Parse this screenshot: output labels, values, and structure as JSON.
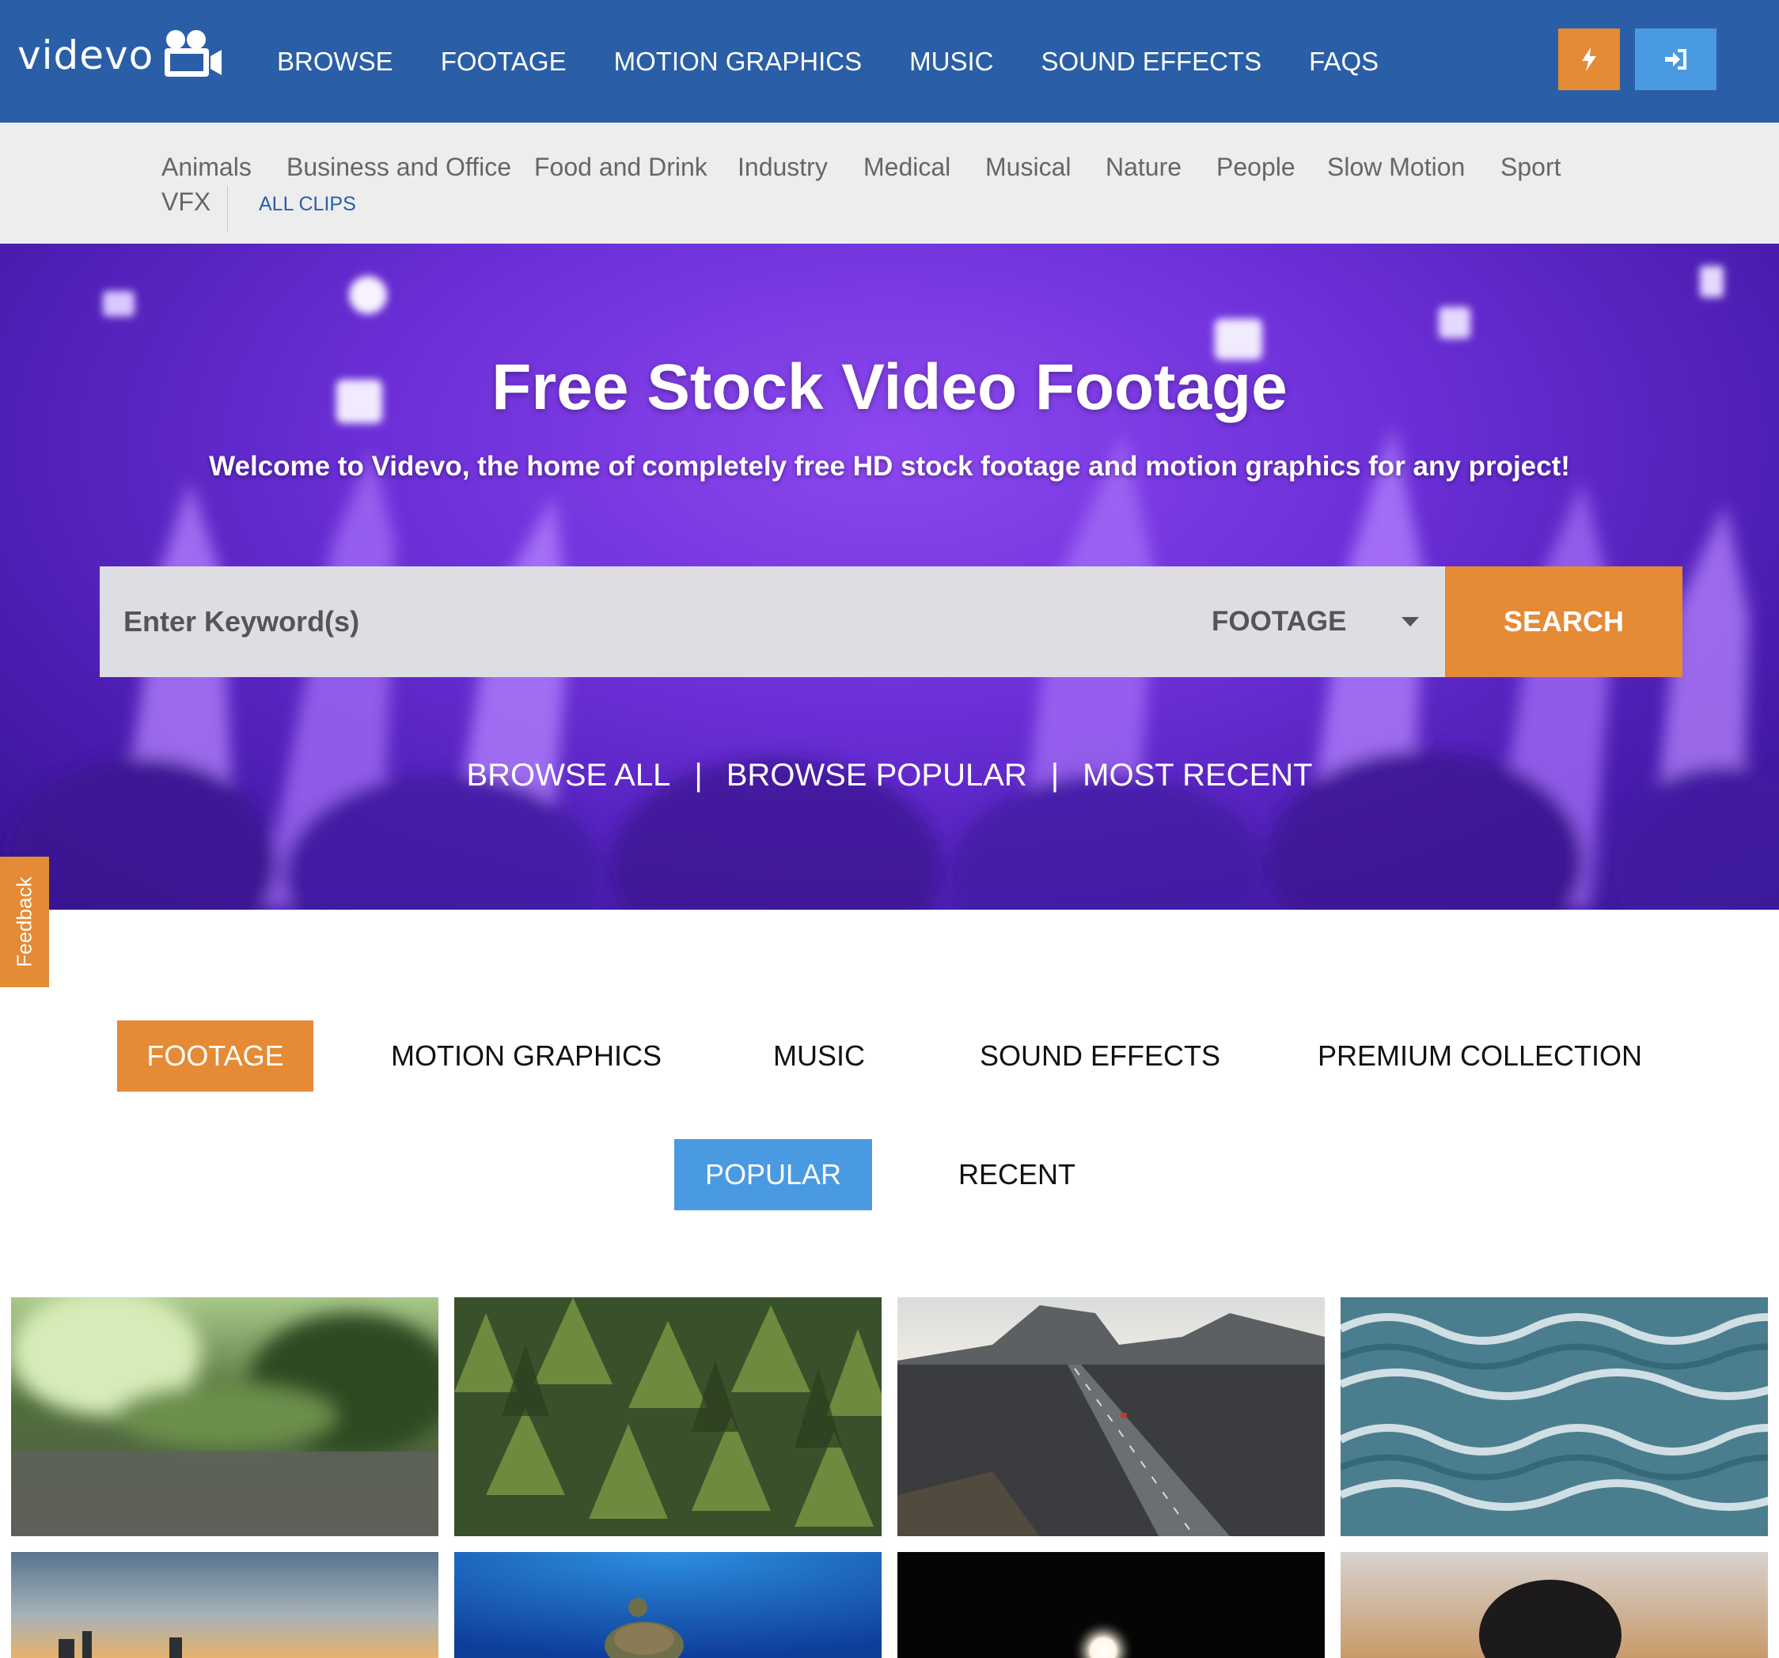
{
  "header": {
    "logo_text": "videvo",
    "nav": [
      "BROWSE",
      "FOOTAGE",
      "MOTION GRAPHICS",
      "MUSIC",
      "SOUND EFFECTS",
      "FAQS"
    ],
    "icons": {
      "bolt": "bolt-icon",
      "login": "sign-in-icon",
      "logo": "video-camera-icon"
    }
  },
  "categories": {
    "items": [
      "Animals",
      "Business and Office",
      "Food and Drink",
      "Industry",
      "Medical",
      "Musical",
      "Nature",
      "People",
      "Slow Motion",
      "Sport",
      "VFX"
    ],
    "all_clips": "ALL CLIPS"
  },
  "hero": {
    "title": "Free Stock Video Footage",
    "subtitle": "Welcome to Videvo, the home of completely free HD stock footage and motion graphics for any project!",
    "search_placeholder": "Enter Keyword(s)",
    "search_type": "FOOTAGE",
    "search_button": "SEARCH",
    "links": [
      "BROWSE ALL",
      "BROWSE POPULAR",
      "MOST RECENT"
    ],
    "separator": "|"
  },
  "feedback_label": "Feedback",
  "content_tabs": {
    "items": [
      "FOOTAGE",
      "MOTION GRAPHICS",
      "MUSIC",
      "SOUND EFFECTS",
      "PREMIUM COLLECTION"
    ],
    "active": "FOOTAGE"
  },
  "sort_tabs": {
    "items": [
      "POPULAR",
      "RECENT"
    ],
    "active": "POPULAR"
  },
  "colors": {
    "nav_blue": "#2a5ea7",
    "accent_orange": "#e58a35",
    "accent_blue": "#4a9ae2",
    "category_bar": "#ededed"
  }
}
